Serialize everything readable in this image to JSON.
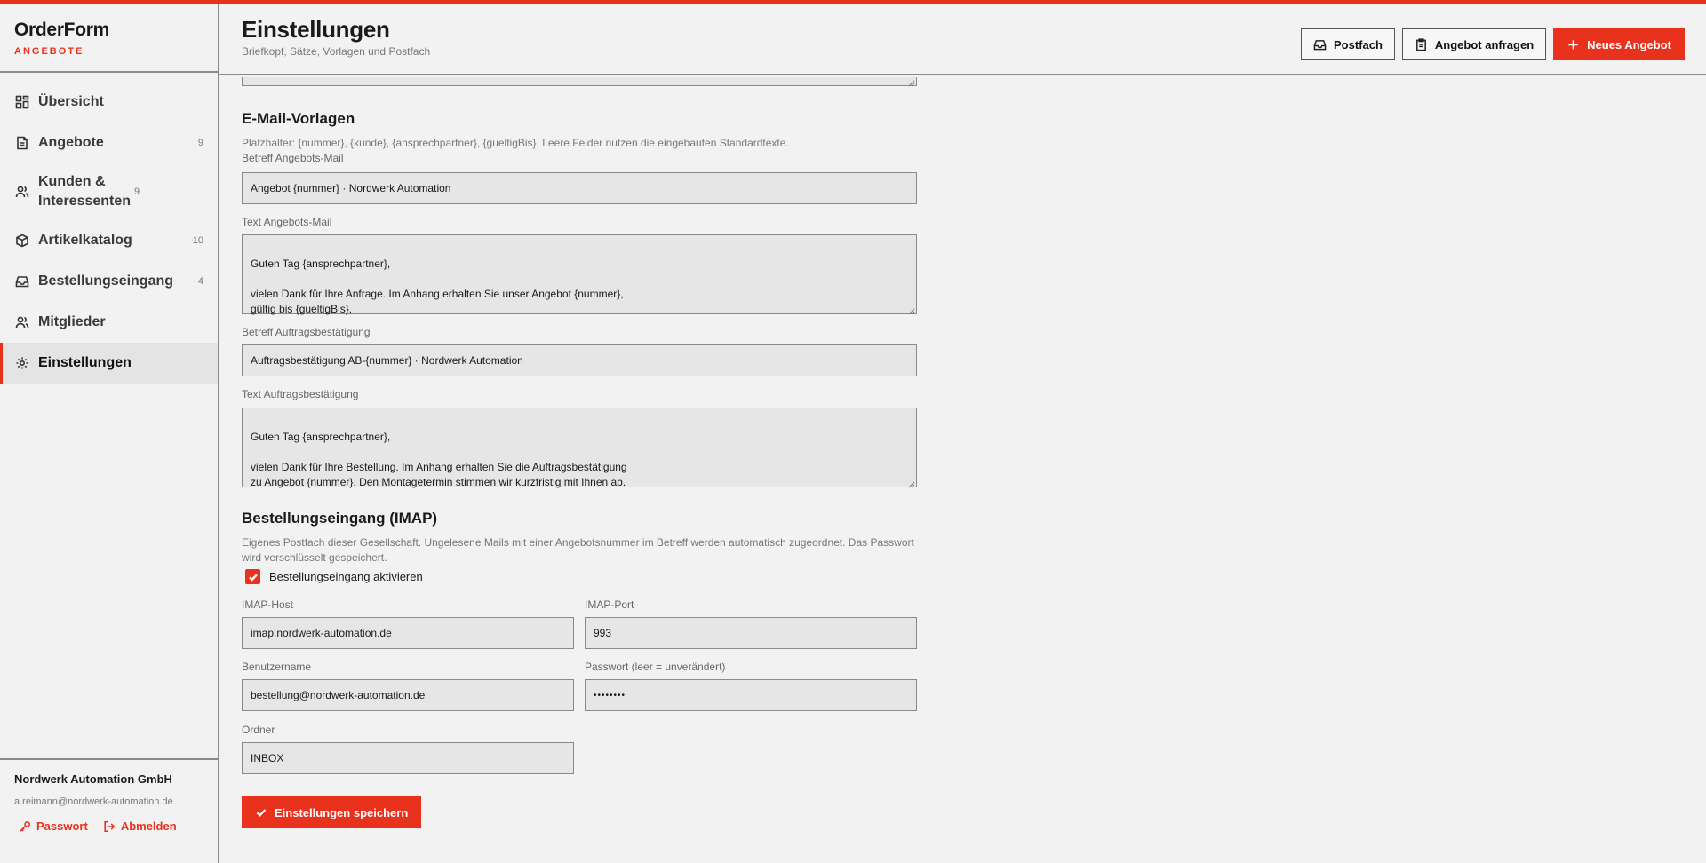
{
  "brand": {
    "title": "OrderForm",
    "subtitle": "ANGEBOTE"
  },
  "sidebar": {
    "items": [
      {
        "label": "Übersicht",
        "count": "",
        "icon": "dashboard-icon"
      },
      {
        "label": "Angebote",
        "count": "9",
        "icon": "document-icon"
      },
      {
        "label": "Kunden & Interessenten",
        "count": "9",
        "icon": "users-icon"
      },
      {
        "label": "Artikelkatalog",
        "count": "10",
        "icon": "box-icon"
      },
      {
        "label": "Bestellungseingang",
        "count": "4",
        "icon": "inbox-icon"
      },
      {
        "label": "Mitglieder",
        "count": "",
        "icon": "users-icon"
      },
      {
        "label": "Einstellungen",
        "count": "",
        "icon": "gear-icon",
        "active": true
      }
    ],
    "footer": {
      "company": "Nordwerk Automation GmbH",
      "email": "a.reimann@nordwerk-automation.de",
      "password_label": "Passwort",
      "logout_label": "Abmelden"
    }
  },
  "header": {
    "title": "Einstellungen",
    "subtitle": "Briefkopf, Sätze, Vorlagen und Postfach",
    "postfach_label": "Postfach",
    "request_label": "Angebot anfragen",
    "new_label": "Neues Angebot"
  },
  "email_templates": {
    "title": "E-Mail-Vorlagen",
    "hint": "Platzhalter: {nummer}, {kunde}, {ansprechpartner}, {gueltigBis}. Leere Felder nutzen die eingebauten Standardtexte.",
    "offer_subject_label": "Betreff Angebots-Mail",
    "offer_subject_value": "Angebot {nummer} · Nordwerk Automation",
    "offer_text_label": "Text Angebots-Mail",
    "offer_text_value": "Guten Tag {ansprechpartner},\n\nvielen Dank für Ihre Anfrage. Im Anhang erhalten Sie unser Angebot {nummer},\ngültig bis {gueltigBis}.",
    "confirm_subject_label": "Betreff Auftragsbestätigung",
    "confirm_subject_value": "Auftragsbestätigung AB-{nummer} · Nordwerk Automation",
    "confirm_text_label": "Text Auftragsbestätigung",
    "confirm_text_value": "Guten Tag {ansprechpartner},\n\nvielen Dank für Ihre Bestellung. Im Anhang erhalten Sie die Auftragsbestätigung\nzu Angebot {nummer}. Den Montagetermin stimmen wir kurzfristig mit Ihnen ab."
  },
  "imap": {
    "title": "Bestellungseingang (IMAP)",
    "hint": "Eigenes Postfach dieser Gesellschaft. Ungelesene Mails mit einer Angebotsnummer im Betreff werden automatisch zugeordnet. Das Passwort wird verschlüsselt gespeichert.",
    "enable_label": "Bestellungseingang aktivieren",
    "enabled": true,
    "host_label": "IMAP-Host",
    "host_value": "imap.nordwerk-automation.de",
    "port_label": "IMAP-Port",
    "port_value": "993",
    "user_label": "Benutzername",
    "user_value": "bestellung@nordwerk-automation.de",
    "password_label": "Passwort (leer = unverändert)",
    "password_value": "••••••••",
    "folder_label": "Ordner",
    "folder_value": "INBOX"
  },
  "save_label": "Einstellungen speichern",
  "colors": {
    "accent": "#e8321e",
    "background": "#f2f2f2",
    "input": "#e6e6e6"
  }
}
